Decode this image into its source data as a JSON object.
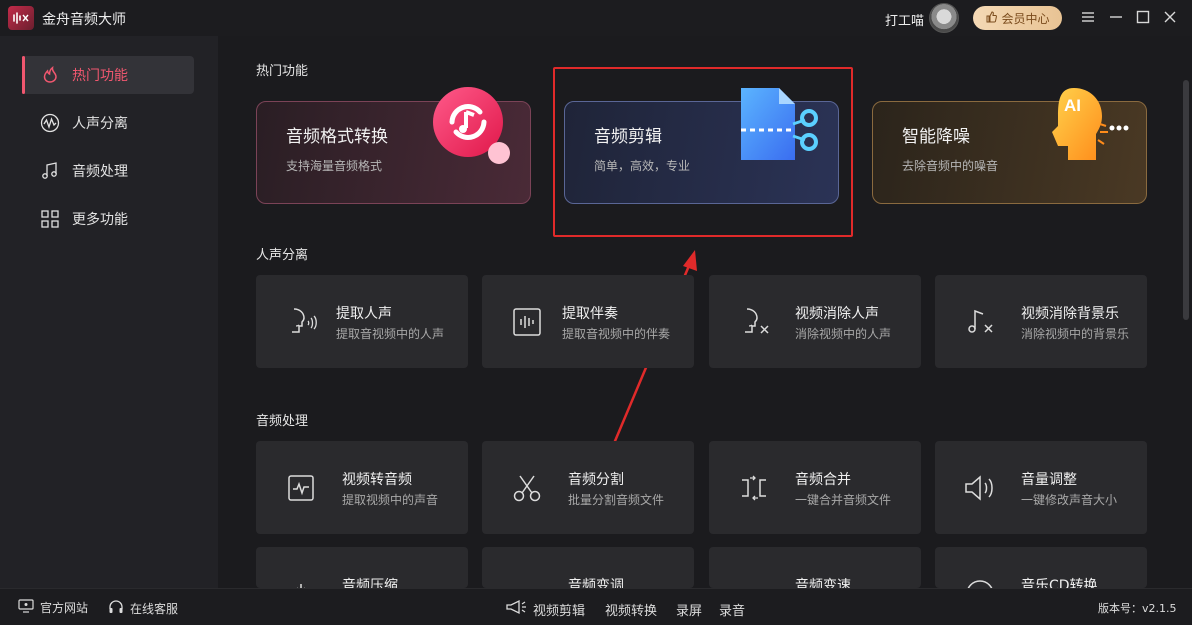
{
  "app": {
    "title": "金舟音频大师",
    "user_name": "打工喵",
    "vip_label": "会员中心"
  },
  "sidebar": {
    "items": [
      {
        "label": "热门功能",
        "icon": "fire-icon",
        "active": true
      },
      {
        "label": "人声分离",
        "icon": "waveform-icon"
      },
      {
        "label": "音频处理",
        "icon": "music-note-icon"
      },
      {
        "label": "更多功能",
        "icon": "grid-icon"
      }
    ]
  },
  "sections": {
    "hot": "热门功能",
    "vocal": "人声分离",
    "audio": "音频处理"
  },
  "hot_cards": [
    {
      "title": "音频格式转换",
      "subtitle": "支持海量音频格式"
    },
    {
      "title": "音频剪辑",
      "subtitle": "简单，高效，专业"
    },
    {
      "title": "智能降噪",
      "subtitle": "去除音频中的噪音"
    }
  ],
  "hot_badge": "AI",
  "vocal_cards": [
    {
      "title": "提取人声",
      "subtitle": "提取音视频中的人声"
    },
    {
      "title": "提取伴奏",
      "subtitle": "提取音视频中的伴奏"
    },
    {
      "title": "视频消除人声",
      "subtitle": "消除视频中的人声"
    },
    {
      "title": "视频消除背景乐",
      "subtitle": "消除视频中的背景乐"
    }
  ],
  "audio_cards": [
    {
      "title": "视频转音频",
      "subtitle": "提取视频中的声音"
    },
    {
      "title": "音频分割",
      "subtitle": "批量分割音频文件"
    },
    {
      "title": "音频合并",
      "subtitle": "一键合并音频文件"
    },
    {
      "title": "音量调整",
      "subtitle": "一键修改声音大小"
    }
  ],
  "partial_cards": [
    {
      "title": "音频压缩"
    },
    {
      "title": "音频变调"
    },
    {
      "title": "音频变速"
    },
    {
      "title": "音乐CD转换"
    }
  ],
  "bottom": {
    "website": "官方网站",
    "support": "在线客服",
    "links": [
      "视频剪辑",
      "视频转换",
      "录屏",
      "录音"
    ],
    "version_label": "版本号：v2.1.5"
  },
  "colors": {
    "accent": "#f0576f",
    "highlight": "#e02a2a"
  }
}
